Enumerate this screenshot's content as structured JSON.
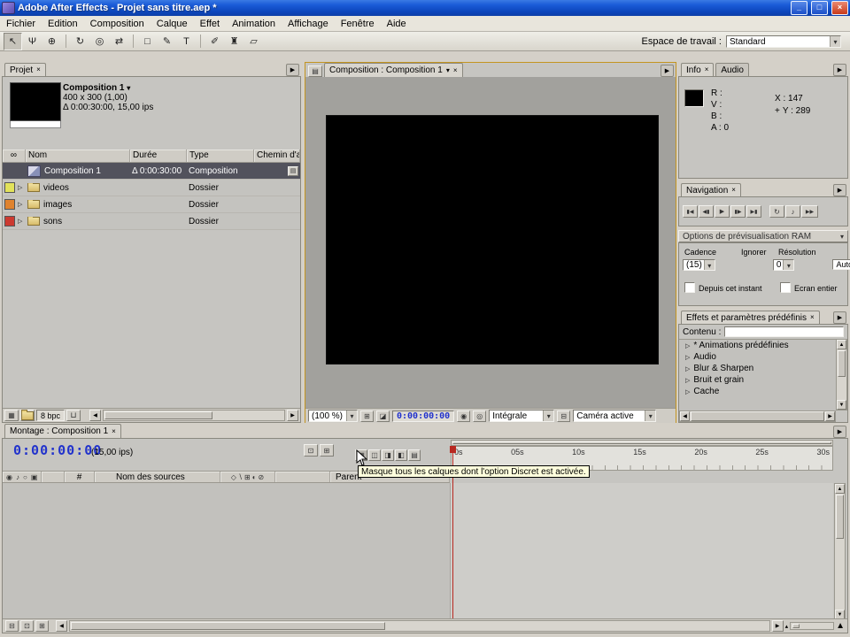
{
  "colors": {
    "titlebar_blue": "#1b5cd8",
    "active_panel_accent": "#c49520",
    "timecode_blue": "#2233cc",
    "selected_row_bg": "#52525c",
    "tooltip_bg": "#ffffdd",
    "cti_red": "#b82820"
  },
  "window": {
    "title": "Adobe After Effects - Projet sans titre.aep *"
  },
  "menu": {
    "items": [
      "Fichier",
      "Edition",
      "Composition",
      "Calque",
      "Effet",
      "Animation",
      "Affichage",
      "Fenêtre",
      "Aide"
    ]
  },
  "toolbar": {
    "tool_glyphs": [
      "↖",
      "Ψ",
      "⊕",
      "↻",
      "◎",
      "⇄",
      "□",
      "✎",
      "T",
      "✐",
      "♜",
      "▱"
    ],
    "workspace_label": "Espace de travail :",
    "workspace_value": "Standard"
  },
  "project": {
    "tab": "Projet",
    "selected_item": {
      "name": "Composition 1",
      "dimensions": "400 x 300 (1,00)",
      "duration": "Δ 0:00:30:00, 15,00 ips"
    },
    "columns": [
      "Nom",
      "Durée",
      "Type",
      "Chemin d'acc"
    ],
    "rows": [
      {
        "name": "Composition 1",
        "duration": "Δ 0:00:30:00",
        "type": "Composition",
        "color": ""
      },
      {
        "name": "videos",
        "duration": "",
        "type": "Dossier",
        "color": "#e2e25a"
      },
      {
        "name": "images",
        "duration": "",
        "type": "Dossier",
        "color": "#e0832e"
      },
      {
        "name": "sons",
        "duration": "",
        "type": "Dossier",
        "color": "#cc3a30"
      }
    ],
    "bit_depth": "8 bpc"
  },
  "composition": {
    "tab": "Composition : Composition 1",
    "zoom": "(100 %)",
    "timecode": "0:00:00:00",
    "resolution": "Intégrale",
    "view": "Caméra active"
  },
  "info": {
    "tabs": [
      "Info",
      "Audio"
    ],
    "channels": [
      "R :",
      "V :",
      "B :",
      "A : 0"
    ],
    "x": "X : 147",
    "y": "Y : 289"
  },
  "navigation": {
    "tab": "Navigation"
  },
  "ram_preview": {
    "title": "Options de prévisualisation RAM",
    "labels": [
      "Cadence",
      "Ignorer",
      "Résolution"
    ],
    "cadence": "(15)",
    "skip": "0",
    "resolution": "Automatique",
    "checkbox_from_current": "Depuis cet instant",
    "checkbox_full_screen": "Ecran entier"
  },
  "effects": {
    "title": "Effets et paramètres prédéfinis",
    "content_label": "Contenu :",
    "items": [
      "* Animations prédéfinies",
      "Audio",
      "Blur & Sharpen",
      "Bruit et grain",
      "Cache"
    ]
  },
  "timeline": {
    "tab": "Montage : Composition 1",
    "timecode": "0:00:00:00",
    "fps": "(15,00 ips)",
    "columns": {
      "hash": "#",
      "source": "Nom des sources",
      "parent": "Parent"
    },
    "ruler": [
      "0s",
      "05s",
      "10s",
      "15s",
      "20s",
      "25s",
      "30s"
    ],
    "tooltip": "Masque tous les calques dont l'option Discret est activée."
  }
}
